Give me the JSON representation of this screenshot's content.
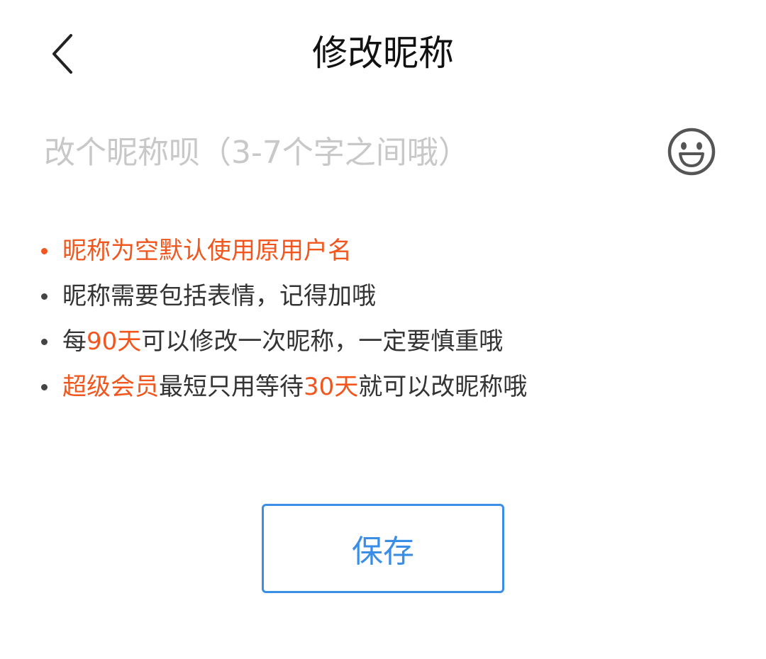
{
  "header": {
    "title": "修改昵称",
    "back_icon": "chevron-left-icon"
  },
  "input": {
    "placeholder": "改个昵称呗（3-7个字之间哦）",
    "value": "",
    "emoji_icon": "smiley-face-icon"
  },
  "tips": [
    {
      "text": "昵称为空默认使用原用户名"
    },
    {
      "text": "昵称需要包括表情，记得加哦"
    },
    {
      "prefix": "每",
      "days": "90天",
      "suffix": "可以修改一次昵称，一定要慎重哦"
    },
    {
      "vip": "超级会员",
      "middle": "最短只用等待",
      "days": "30天",
      "suffix": "就可以改昵称哦"
    }
  ],
  "save_label": "保存",
  "colors": {
    "accent_orange": "#f0561d",
    "button_blue": "#3a8ee6",
    "placeholder_gray": "#c8c8c8",
    "text_dark": "#333333"
  }
}
